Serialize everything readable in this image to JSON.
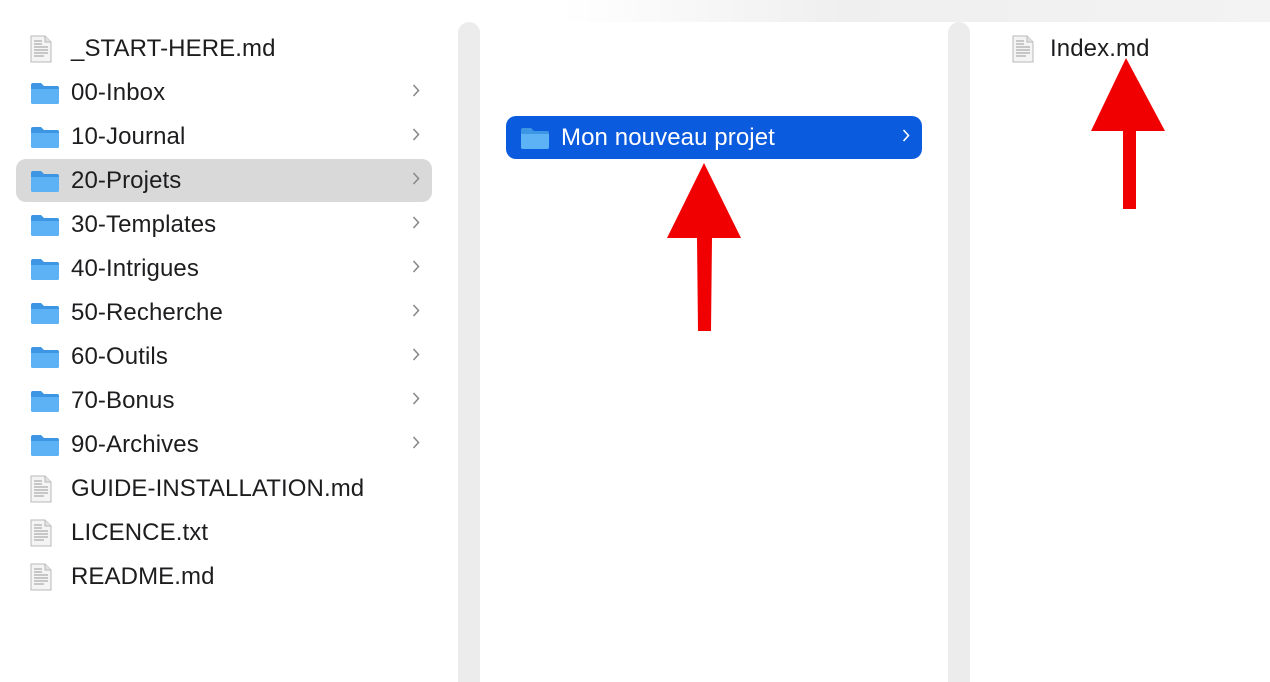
{
  "colors": {
    "folder": "#4aa6ee",
    "selected_gray": "#d9d9d9",
    "selected_blue": "#0b5bde",
    "arrow": "#f00000"
  },
  "column1": {
    "items": [
      {
        "label": "_START-HERE.md",
        "type": "file",
        "icon": "document-icon"
      },
      {
        "label": "00-Inbox",
        "type": "folder",
        "icon": "folder-icon"
      },
      {
        "label": "10-Journal",
        "type": "folder",
        "icon": "folder-icon"
      },
      {
        "label": "20-Projets",
        "type": "folder",
        "icon": "folder-icon",
        "selected": true
      },
      {
        "label": "30-Templates",
        "type": "folder",
        "icon": "folder-icon"
      },
      {
        "label": "40-Intrigues",
        "type": "folder",
        "icon": "folder-icon"
      },
      {
        "label": "50-Recherche",
        "type": "folder",
        "icon": "folder-icon"
      },
      {
        "label": "60-Outils",
        "type": "folder",
        "icon": "folder-icon"
      },
      {
        "label": "70-Bonus",
        "type": "folder",
        "icon": "folder-icon"
      },
      {
        "label": "90-Archives",
        "type": "folder",
        "icon": "folder-icon"
      },
      {
        "label": "GUIDE-INSTALLATION.md",
        "type": "file",
        "icon": "document-icon"
      },
      {
        "label": "LICENCE.txt",
        "type": "file",
        "icon": "document-icon"
      },
      {
        "label": "README.md",
        "type": "file",
        "icon": "document-icon"
      }
    ]
  },
  "column2": {
    "items": [
      {
        "label": "Mon nouveau projet",
        "type": "folder",
        "icon": "folder-icon",
        "selected": true
      }
    ]
  },
  "column3": {
    "items": [
      {
        "label": "Index.md",
        "type": "file",
        "icon": "document-icon"
      }
    ]
  },
  "annotations": [
    {
      "type": "arrow",
      "icon": "red-arrow-up",
      "points_to": "Mon nouveau projet"
    },
    {
      "type": "arrow",
      "icon": "red-arrow-up",
      "points_to": "Index.md"
    }
  ]
}
